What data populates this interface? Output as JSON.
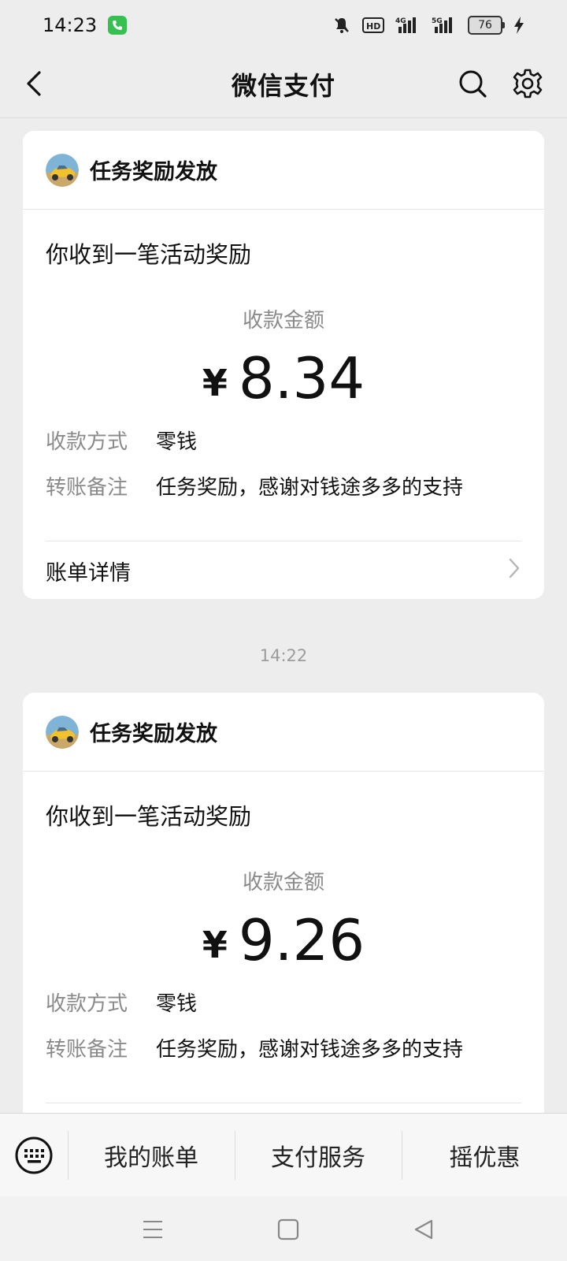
{
  "status_bar": {
    "time": "14:23",
    "network_4g": "4G",
    "network_5g": "5G",
    "hd_label": "HD",
    "battery": "76",
    "icons": [
      "phone-call-icon",
      "mute-bell-icon",
      "hd-icon",
      "signal-4g-icon",
      "signal-5g-icon",
      "battery-icon",
      "charging-icon"
    ]
  },
  "header": {
    "title": "微信支付",
    "icons": [
      "back-arrow-icon",
      "search-icon",
      "gear-icon"
    ]
  },
  "cards": [
    {
      "sender": "任务奖励发放",
      "headline": "你收到一笔活动奖励",
      "amount_label": "收款金额",
      "currency": "¥",
      "amount": "8.34",
      "method_key": "收款方式",
      "method_value": "零钱",
      "note_key": "转账备注",
      "note_value": "任务奖励，感谢对钱途多多的支持",
      "details_label": "账单详情"
    },
    {
      "sender": "任务奖励发放",
      "headline": "你收到一笔活动奖励",
      "amount_label": "收款金额",
      "currency": "¥",
      "amount": "9.26",
      "method_key": "收款方式",
      "method_value": "零钱",
      "note_key": "转账备注",
      "note_value": "任务奖励，感谢对钱途多多的支持"
    }
  ],
  "timestamp": "14:22",
  "bottom_menu": {
    "items": [
      "我的账单",
      "支付服务",
      "摇优惠"
    ],
    "icons": [
      "keyboard-icon"
    ]
  },
  "nav_bar": {
    "icons": [
      "menu-lines-icon",
      "home-square-icon",
      "back-triangle-icon"
    ]
  },
  "colors": {
    "background": "#ededed",
    "card": "#ffffff",
    "muted_text": "#8a8a8a",
    "call_badge": "#36c050"
  }
}
